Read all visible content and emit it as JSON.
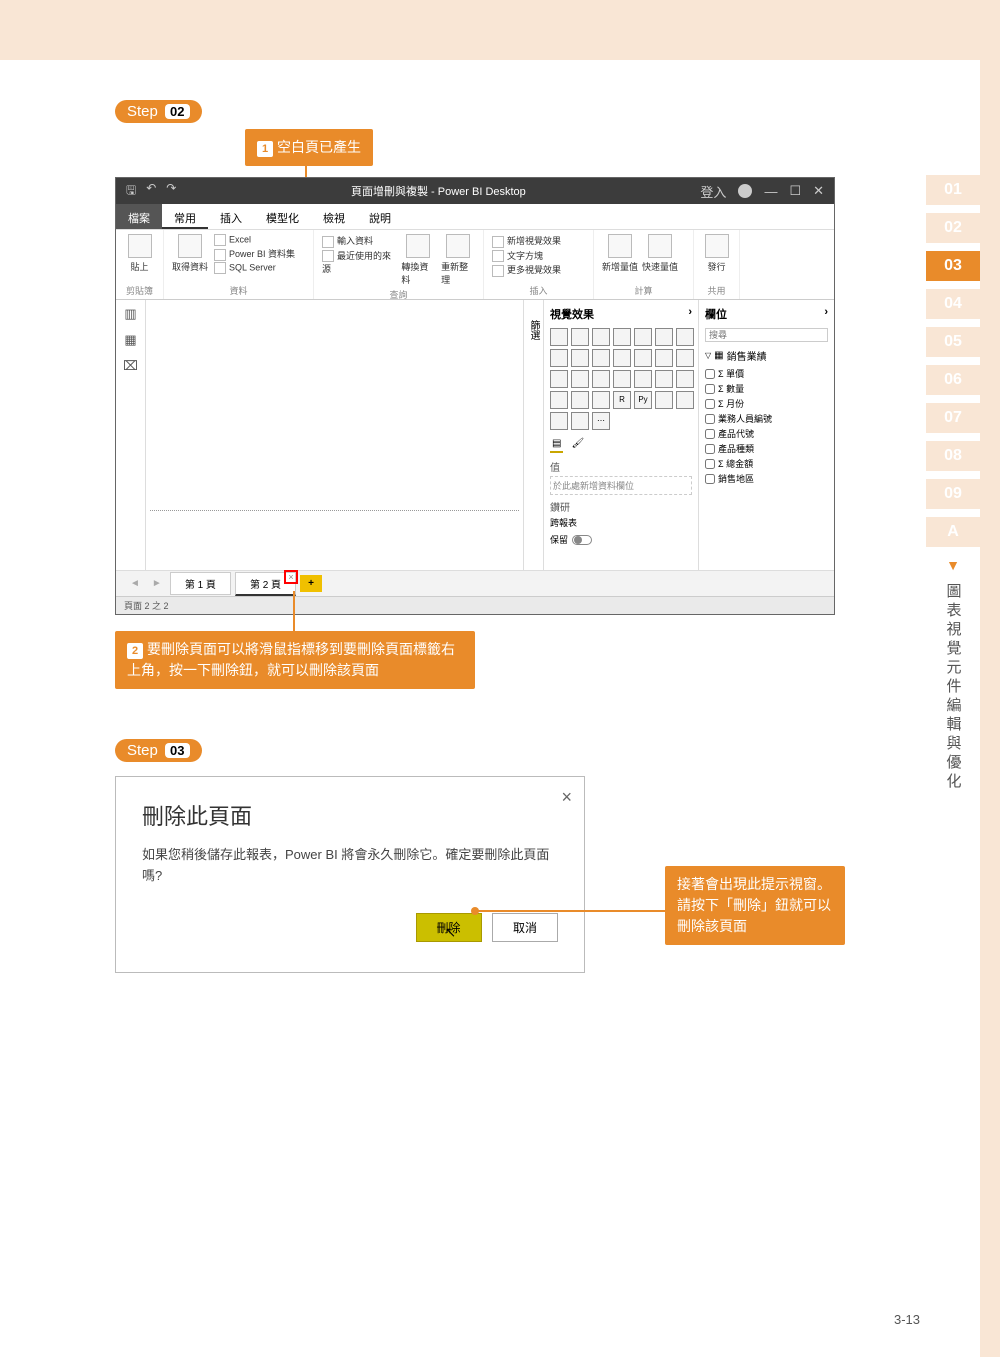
{
  "chapter_tabs": [
    "01",
    "02",
    "03",
    "04",
    "05",
    "06",
    "07",
    "08",
    "09",
    "A"
  ],
  "active_chapter": "03",
  "side_arrow": "▼",
  "side_title": "圖表視覺元件編輯與優化",
  "step2_label": "Step",
  "step2_num": "02",
  "callout1": "空白頁已產生",
  "callout2": "要刪除頁面可以將滑鼠指標移到要刪除頁面標籤右上角，按一下刪除鈕，就可以刪除該頁面",
  "pbi": {
    "title": "頁面增刪與複製 - Power BI Desktop",
    "signin": "登入",
    "tabs": {
      "file": "檔案",
      "home": "常用",
      "insert": "插入",
      "modeling": "模型化",
      "view": "檢視",
      "help": "說明"
    },
    "ribbon": {
      "clipboard": {
        "paste": "貼上",
        "group": "剪貼簿"
      },
      "data": {
        "getdata": "取得資料",
        "excel": "Excel",
        "pbids": "Power BI 資料集",
        "sql": "SQL Server",
        "group": "資料"
      },
      "queries": {
        "enter": "輸入資料",
        "recent": "最近使用的來源",
        "transform": "轉換資料",
        "refresh": "重新整理",
        "group": "查詢"
      },
      "insert": {
        "newviz": "新增視覺效果",
        "textbox": "文字方塊",
        "more": "更多視覺效果",
        "group": "插入"
      },
      "calc": {
        "newmeasure": "新增量值",
        "quick": "快速量值",
        "group": "計算"
      },
      "share": {
        "publish": "發行",
        "group": "共用"
      }
    },
    "filters_label": "篩選",
    "viz": {
      "title": "視覺效果",
      "values": "值",
      "drop_hint": "於此處新增資料欄位",
      "drillthrough": "鑽研",
      "cross": "跨報表",
      "keep": "保留"
    },
    "fields": {
      "title": "欄位",
      "search_ph": "搜尋",
      "table": "銷售業績",
      "items": [
        "Σ  單價",
        "Σ  數量",
        "Σ  月份",
        "   業務人員編號",
        "   產品代號",
        "   產品種類",
        "Σ  總金額",
        "   銷售地區"
      ]
    },
    "pages": {
      "p1": "第 1 頁",
      "p2": "第 2 頁",
      "add": "+",
      "status": "頁面 2 之 2"
    }
  },
  "step3_label": "Step",
  "step3_num": "03",
  "dialog": {
    "title": "刪除此頁面",
    "body": "如果您稍後儲存此報表，Power BI 將會永久刪除它。確定要刪除此頁面嗎?",
    "delete": "刪除",
    "cancel": "取消"
  },
  "callout3": "接著會出現此提示視窗。請按下「刪除」鈕就可以刪除該頁面",
  "page_number": "3-13"
}
